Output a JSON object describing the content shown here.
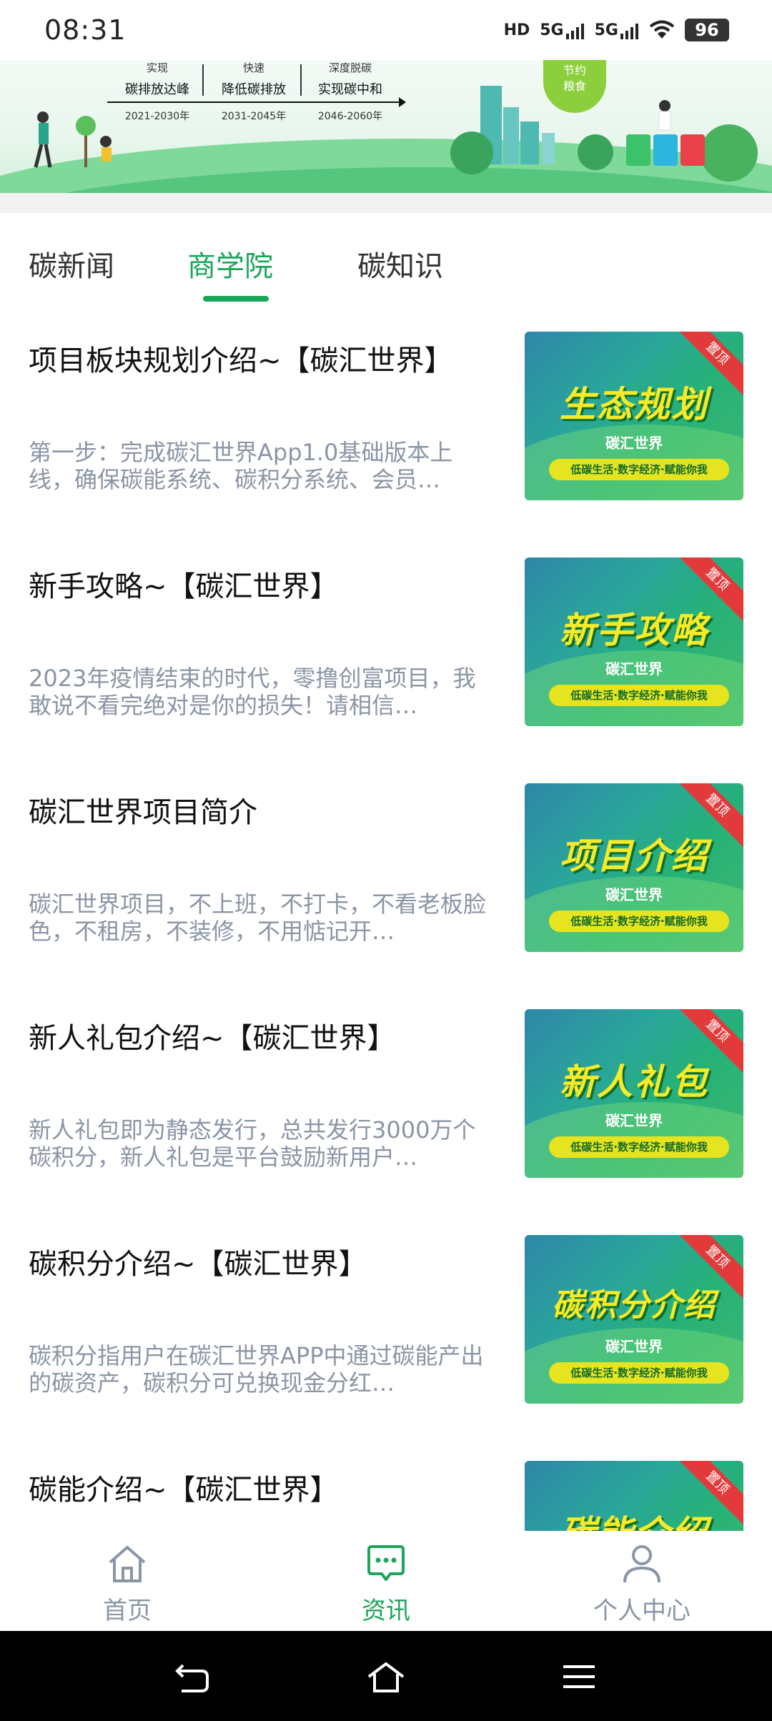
{
  "status": {
    "time": "08:31",
    "hd": "HD",
    "net1": "5G",
    "net2": "5G",
    "battery": "96"
  },
  "banner": {
    "cols": [
      {
        "top": "实现",
        "main": "碳排放达峰",
        "year": "2021-2030年"
      },
      {
        "top": "快速",
        "main": "降低碳排放",
        "year": "2031-2045年"
      },
      {
        "top": "深度脱碳",
        "main": "实现碳中和",
        "year": "2046-2060年"
      }
    ],
    "save_line1": "节约",
    "save_line2": "粮食"
  },
  "tabs": [
    {
      "label": "碳新闻",
      "active": false
    },
    {
      "label": "商学院",
      "active": true
    },
    {
      "label": "碳知识",
      "active": false
    }
  ],
  "articles": [
    {
      "title": "项目板块规划介绍~【碳汇世界】",
      "desc": "第一步：完成碳汇世界App1.0基础版本上线，确保碳能系统、碳积分系统、会员…",
      "thumb_title": "生态规划"
    },
    {
      "title": "新手攻略~【碳汇世界】",
      "desc": "2023年疫情结束的时代，零撸创富项目，我敢说不看完绝对是你的损失！请相信…",
      "thumb_title": "新手攻略"
    },
    {
      "title": "碳汇世界项目简介",
      "desc": "碳汇世界项目，不上班，不打卡，不看老板脸色，不租房，不装修，不用惦记开…",
      "thumb_title": "项目介绍"
    },
    {
      "title": "新人礼包介绍~【碳汇世界】",
      "desc": "新人礼包即为静态发行，总共发行3000万个碳积分，新人礼包是平台鼓励新用户…",
      "thumb_title": "新人礼包"
    },
    {
      "title": "碳积分介绍~【碳汇世界】",
      "desc": "碳积分指用户在碳汇世界APP中通过碳能产出的碳资产，碳积分可兑换现金分红…",
      "thumb_title": "碳积分介绍"
    },
    {
      "title": "碳能介绍~【碳汇世界】",
      "desc": "",
      "thumb_title": "碳能介绍"
    }
  ],
  "thumb_common": {
    "brand": "碳汇世界",
    "slogan": "低碳生活·数字经济·赋能你我",
    "ribbon": "置顶"
  },
  "bottom_nav": [
    {
      "label": "首页",
      "icon": "home-icon",
      "active": false
    },
    {
      "label": "资讯",
      "icon": "message-icon",
      "active": true
    },
    {
      "label": "个人中心",
      "icon": "user-icon",
      "active": false
    }
  ],
  "colors": {
    "accent": "#1ca65a",
    "muted": "#8a96a6",
    "ribbon": "#e23a3a",
    "headline": "#f7ea28"
  }
}
